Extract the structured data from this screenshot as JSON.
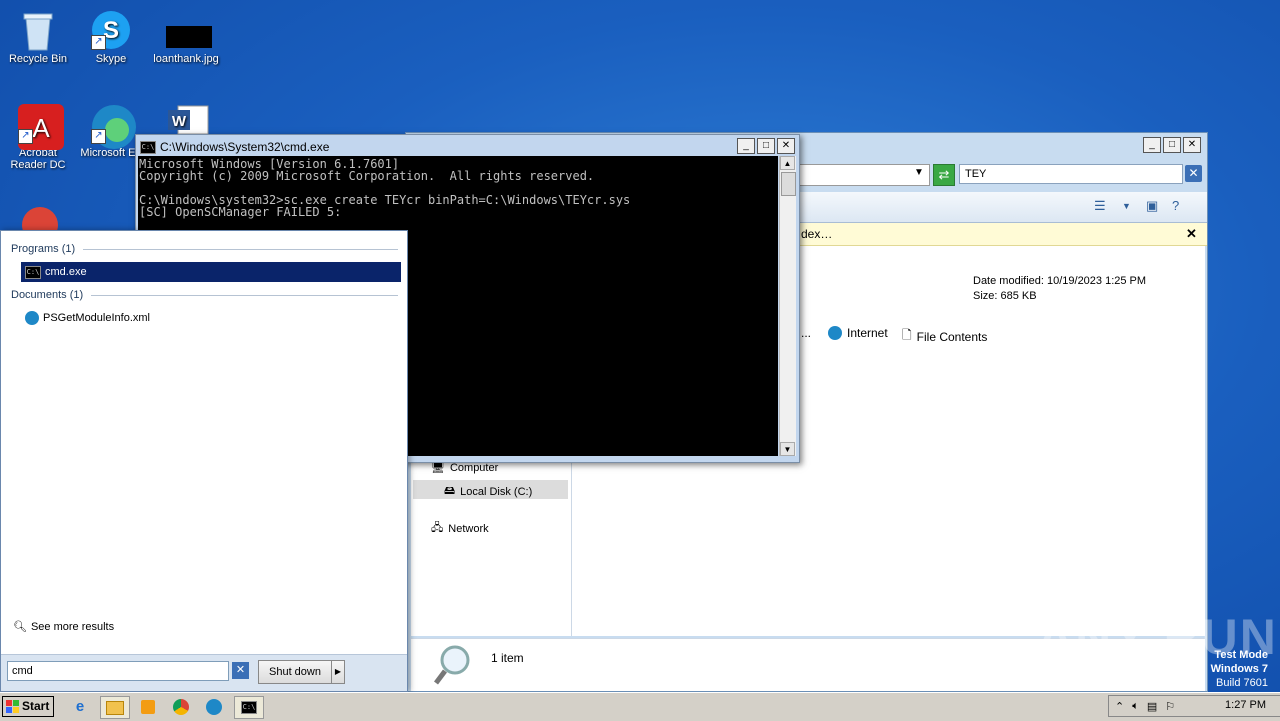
{
  "desktop": {
    "icons": [
      {
        "label": "Recycle Bin"
      },
      {
        "label": "Skype"
      },
      {
        "label": "loanthank.jpg"
      },
      {
        "label": "Acrobat Reader DC"
      },
      {
        "label": "Microsoft Ed"
      },
      {
        "label": ""
      }
    ]
  },
  "explorer": {
    "search_value": "TEY",
    "infobar_text": "dex…",
    "file_meta": {
      "date_modified": "Date modified: 10/19/2023 1:25 PM",
      "size": "Size: 685 KB"
    },
    "search_again": {
      "ellipsis": "...",
      "internet": "Internet",
      "file_contents": "File Contents"
    },
    "nav": {
      "computer": "Computer",
      "local_disk": "Local Disk (C:)",
      "network": "Network"
    },
    "status_count": "1 item"
  },
  "cmd": {
    "title": "C:\\Windows\\System32\\cmd.exe",
    "icon_text": "C:\\",
    "lines": [
      "Microsoft Windows [Version 6.1.7601]",
      "Copyright (c) 2009 Microsoft Corporation.  All rights reserved.",
      "",
      "C:\\Windows\\system32>sc.exe create TEYcr binPath=C:\\Windows\\TEYcr.sys",
      "[SC] OpenSCManager FAILED 5:"
    ]
  },
  "start_menu": {
    "programs_header": "Programs (1)",
    "program_item": "cmd.exe",
    "documents_header": "Documents (1)",
    "document_item": "PSGetModuleInfo.xml",
    "see_more": "See more results",
    "search_value": "cmd",
    "shutdown_label": "Shut down"
  },
  "taskbar": {
    "start_label": "Start",
    "clock": "1:27 PM"
  },
  "watermark": {
    "line1": "Test Mode",
    "line2": "Windows 7",
    "line3": "Build 7601",
    "brand": "ANY RUN"
  },
  "colors": {
    "desktop": "#1a5fbf",
    "selection": "#0a246a",
    "console_bg": "#000000",
    "console_fg": "#c0c0c0"
  }
}
